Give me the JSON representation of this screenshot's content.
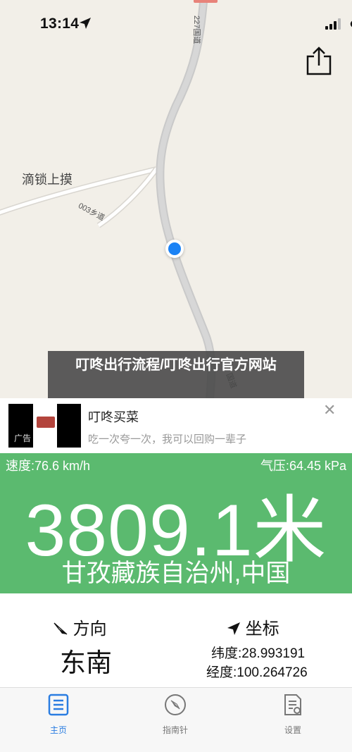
{
  "status_bar": {
    "time": "13:14"
  },
  "map": {
    "place_label": "滴锁上摸",
    "road_227_top": "227国道",
    "road_227_bottom": "国道",
    "road_003": "003乡道"
  },
  "overlay_title": "叮咚出行流程/叮咚出行官方网站",
  "ad": {
    "badge": "广告",
    "title": "叮咚买菜",
    "subtitle": "吃一次夸一次，我可以回购一辈子",
    "close": "✕"
  },
  "readings": {
    "speed": "速度:76.6 km/h",
    "pressure": "气压:64.45 kPa",
    "altitude": "3809.1米",
    "region": "甘孜藏族自治州,中国"
  },
  "direction": {
    "heading": "方向",
    "value": "东南"
  },
  "coordinates": {
    "heading": "坐标",
    "latitude": "纬度:28.993191",
    "longitude": "经度:100.264726"
  },
  "tabs": [
    {
      "label": "主页",
      "icon": "list-icon",
      "active": true
    },
    {
      "label": "指南针",
      "icon": "compass-icon",
      "active": false
    },
    {
      "label": "设置",
      "icon": "settings-doc-icon",
      "active": false
    }
  ],
  "colors": {
    "accent_green": "#5bba6f",
    "active_tab": "#2a7de1",
    "location_dot": "#1a82f5"
  }
}
